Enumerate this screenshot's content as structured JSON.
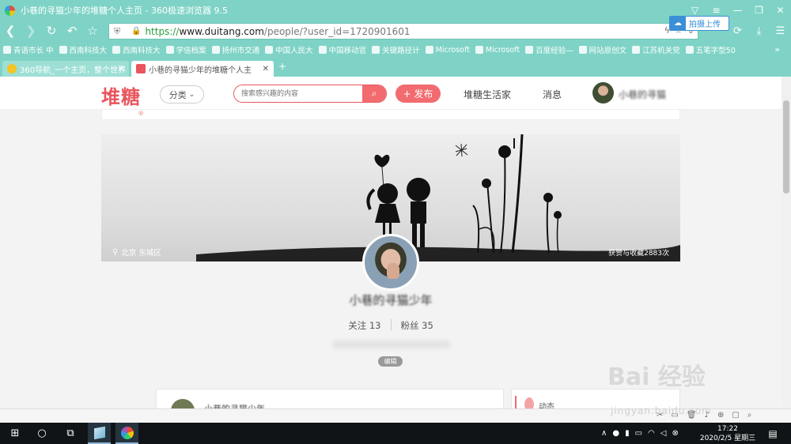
{
  "browser": {
    "title": "小巷的寻猫少年的堆糖个人主页 - 360极速浏览器 9.5",
    "url_scheme": "https://",
    "url_host": "www.duitang.com",
    "url_path": "/people/?user_id=1720901601",
    "upload_label": "拍摄上传",
    "bookmarks": [
      "青语市长 中",
      "西南科技大",
      "西南科技大",
      "学信档案",
      "扬州市交通",
      "中国人民大",
      "中国移动官",
      "关键路径计",
      "Microsoft",
      "Microsoft",
      "百度经验—",
      "网站原创文",
      "江苏机关党",
      "五笔字型50"
    ],
    "bookmarks_more": "»",
    "tabs": [
      {
        "label": "360导航_一个主页，整个世界"
      },
      {
        "label": "小巷的寻猫少年的堆糖个人主"
      }
    ],
    "new_tab": "+"
  },
  "site": {
    "logo": "堆糖",
    "category_label": "分类",
    "search_placeholder": "搜索感兴趣的内容",
    "publish_label": "+ 发布",
    "nav_home": "堆糖生活家",
    "nav_messages": "消息",
    "nav_username": "小巷的寻猫"
  },
  "profile": {
    "location": "北京 东城区",
    "stat": "获赞与收藏2883次",
    "name": "小巷的寻猫少年",
    "following_label": "关注 13",
    "followers_label": "粉丝 35",
    "edit_label": "编辑"
  },
  "cards": {
    "left_name": "小巷的寻猫少年",
    "right_label": "动态"
  },
  "watermark": {
    "main": "Bai 经验",
    "sub": "jingyan.baidu.com"
  },
  "taskbar": {
    "time": "17:22",
    "date": "2020/2/5 星期三"
  },
  "colors": {
    "browser_chrome": "#7fd3c6",
    "brand_red": "#e8555d",
    "accent_btn": "#f26b6f",
    "taskbar": "#101417"
  }
}
